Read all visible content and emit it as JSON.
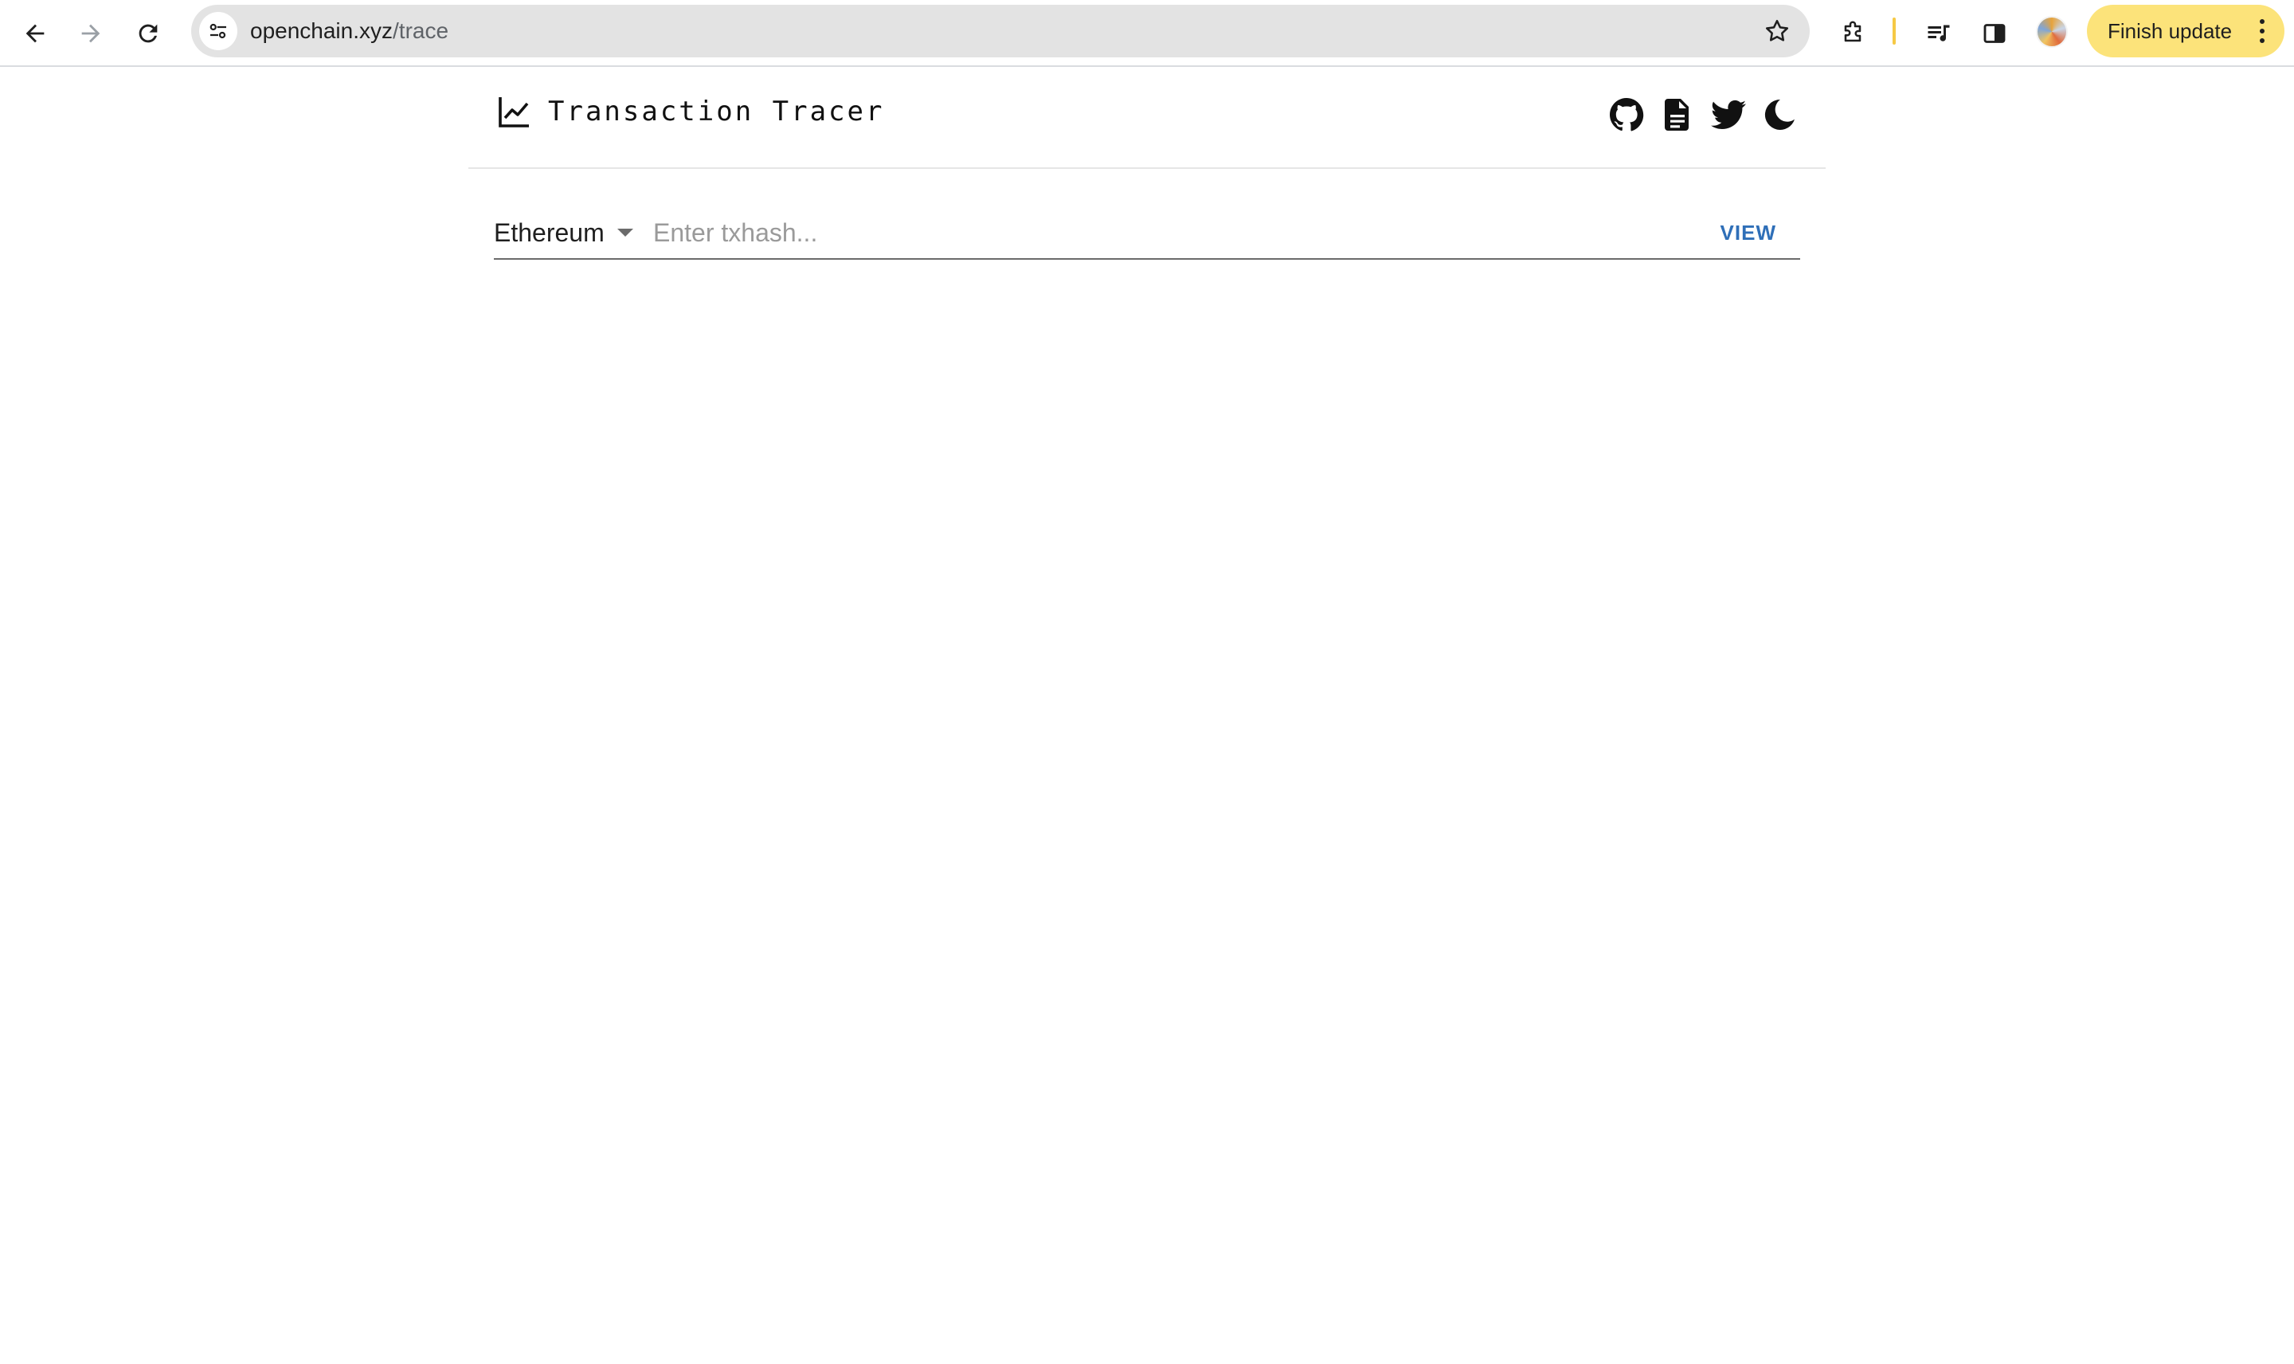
{
  "browser": {
    "url_host": "openchain.xyz",
    "url_path": "/trace",
    "finish_update_label": "Finish update"
  },
  "site": {
    "title": "Transaction Tracer"
  },
  "search": {
    "chain": "Ethereum",
    "placeholder": "Enter txhash...",
    "view_label": "VIEW"
  },
  "icons": {
    "logo": "chart-line-icon",
    "header": [
      "github-icon",
      "document-icon",
      "twitter-icon",
      "moon-icon"
    ]
  },
  "colors": {
    "accent": "#2f6fb8",
    "update_button": "#fce37a"
  }
}
